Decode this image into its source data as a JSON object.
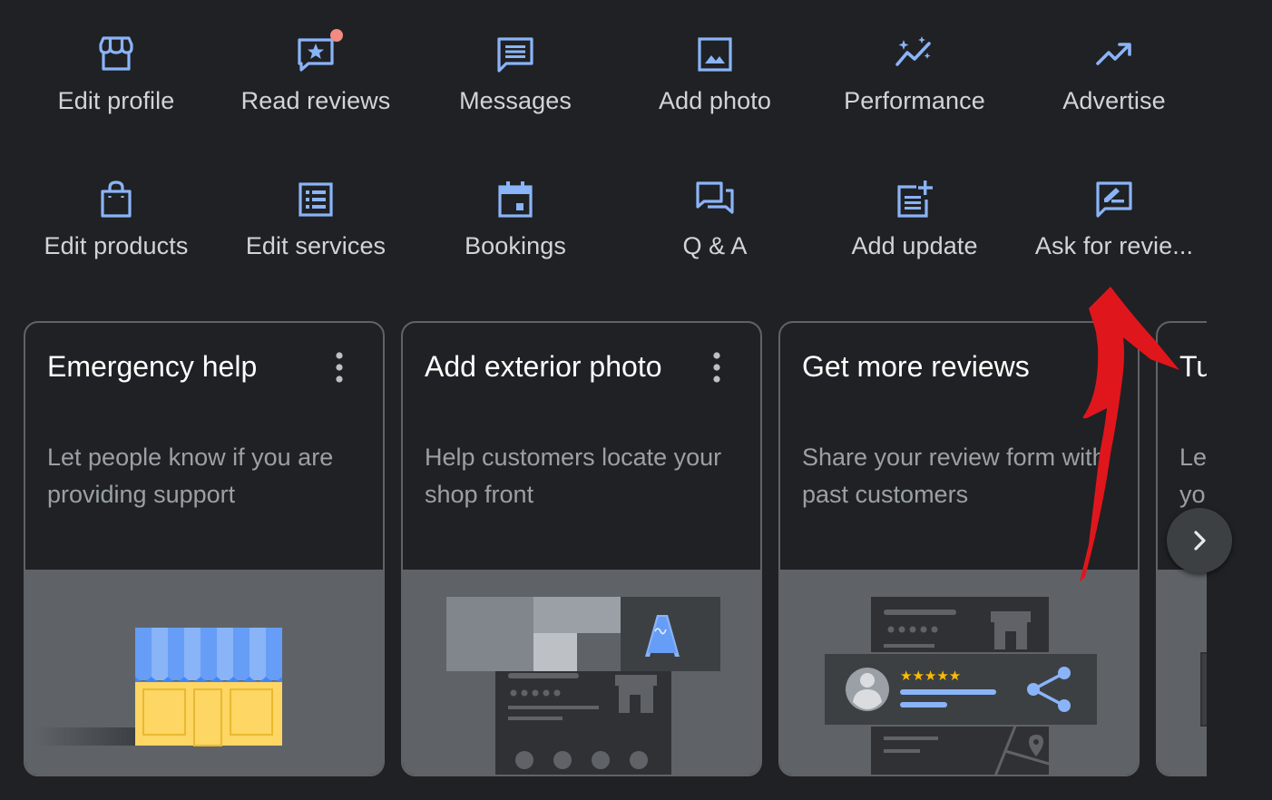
{
  "actions": [
    {
      "label": "Edit profile",
      "icon": "storefront-icon"
    },
    {
      "label": "Read reviews",
      "icon": "review-star-icon"
    },
    {
      "label": "Messages",
      "icon": "message-icon"
    },
    {
      "label": "Add photo",
      "icon": "photo-icon"
    },
    {
      "label": "Performance",
      "icon": "performance-sparkle-icon"
    },
    {
      "label": "Advertise",
      "icon": "trending-up-icon"
    },
    {
      "label": "Edit products",
      "icon": "shopping-bag-icon"
    },
    {
      "label": "Edit services",
      "icon": "list-icon"
    },
    {
      "label": "Bookings",
      "icon": "calendar-icon"
    },
    {
      "label": "Q & A",
      "icon": "forum-icon"
    },
    {
      "label": "Add update",
      "icon": "post-add-icon"
    },
    {
      "label": "Ask for revie...",
      "icon": "rate-review-icon"
    }
  ],
  "cards": [
    {
      "title": "Emergency help",
      "description": "Let people know if you are providing support"
    },
    {
      "title": "Add exterior photo",
      "description": "Help customers locate your shop front"
    },
    {
      "title": "Get more reviews",
      "description": "Share your review form with past customers"
    },
    {
      "title": "Tu",
      "description": "Le yo"
    }
  ],
  "colors": {
    "background": "#202124",
    "icon_blue": "#8ab4f8",
    "notification_dot": "#f28b82",
    "annotation_arrow": "#e0161d",
    "star_yellow": "#fbbc04"
  }
}
